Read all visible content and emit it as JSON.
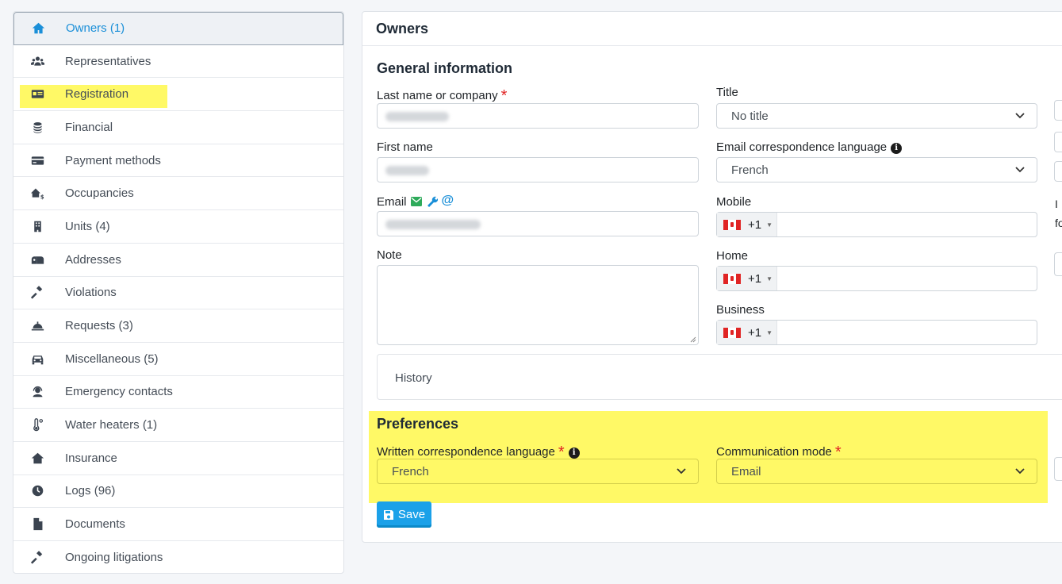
{
  "sidebar": {
    "items": [
      {
        "label": "Owners  (1)",
        "icon": "home-icon",
        "active": true
      },
      {
        "label": "Representatives",
        "icon": "users-icon"
      },
      {
        "label": "Registration",
        "icon": "id-card-icon"
      },
      {
        "label": "Financial",
        "icon": "coins-icon"
      },
      {
        "label": "Payment methods",
        "icon": "credit-card-icon"
      },
      {
        "label": "Occupancies",
        "icon": "houses-dollar-icon"
      },
      {
        "label": "Units  (4)",
        "icon": "building-icon"
      },
      {
        "label": "Addresses",
        "icon": "mailbox-icon"
      },
      {
        "label": "Violations",
        "icon": "gavel-icon"
      },
      {
        "label": "Requests  (3)",
        "icon": "bell-concierge-icon"
      },
      {
        "label": "Miscellaneous  (5)",
        "icon": "car-icon"
      },
      {
        "label": "Emergency contacts",
        "icon": "headset-icon"
      },
      {
        "label": "Water heaters  (1)",
        "icon": "thermometer-icon"
      },
      {
        "label": "Insurance",
        "icon": "house-icon"
      },
      {
        "label": "Logs  (96)",
        "icon": "clock-icon"
      },
      {
        "label": "Documents",
        "icon": "file-icon"
      },
      {
        "label": "Ongoing litigations",
        "icon": "gavel-icon"
      }
    ]
  },
  "panel": {
    "title": "Owners",
    "general_title": "General information",
    "last_name_label": "Last name or company",
    "first_name_label": "First name",
    "email_label": "Email",
    "note_label": "Note",
    "title_label": "Title",
    "title_value": "No title",
    "email_lang_label": "Email correspondence language",
    "email_lang_value": "French",
    "mobile_label": "Mobile",
    "home_label": "Home",
    "business_label": "Business",
    "dial_code": "+1",
    "history_label": "History",
    "preferences_title": "Preferences",
    "written_lang_label": "Written correspondence language",
    "written_lang_value": "French",
    "comm_mode_label": "Communication mode",
    "comm_mode_value": "Email",
    "save_label": "Save",
    "required_mark": "*",
    "info_mark": "i"
  },
  "edge": {
    "text1": "I",
    "text2": "fo"
  },
  "colors": {
    "accent": "#1ba1e9",
    "highlight": "#fff966",
    "required": "#e02424",
    "email_icon": "#2eaa5a",
    "wrench_icon": "#1a8fd8"
  }
}
